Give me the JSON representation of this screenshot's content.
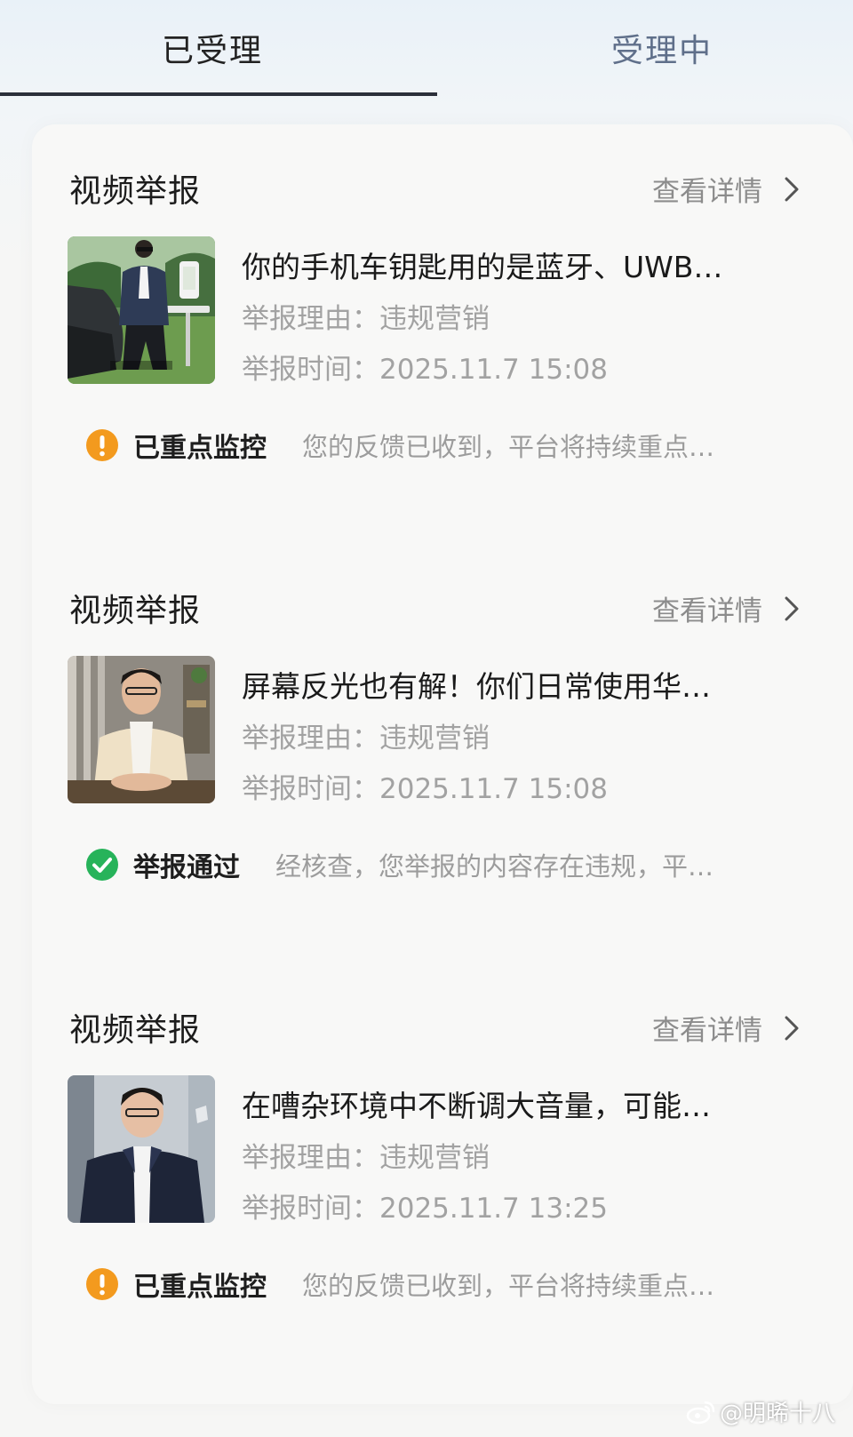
{
  "tabs": [
    {
      "label": "已受理",
      "active": true
    },
    {
      "label": "受理中",
      "active": false
    }
  ],
  "reports": [
    {
      "type": "视频举报",
      "detail_label": "查看详情",
      "title": "你的手机车钥匙用的是蓝牙、UWB…",
      "reason": "举报理由：违规营销",
      "time": "举报时间：2025.11.7 15:08",
      "status_label": "已重点监控",
      "status_icon": "warning-icon",
      "status_color": "#f39a1e",
      "status_message": "您的反馈已收到，平台将持续重点…"
    },
    {
      "type": "视频举报",
      "detail_label": "查看详情",
      "title": "屏幕反光也有解！你们日常使用华…",
      "reason": "举报理由：违规营销",
      "time": "举报时间：2025.11.7 15:08",
      "status_label": "举报通过",
      "status_icon": "check-icon",
      "status_color": "#27b35a",
      "status_message": "经核查，您举报的内容存在违规，平…"
    },
    {
      "type": "视频举报",
      "detail_label": "查看详情",
      "title": "在嘈杂环境中不断调大音量，可能…",
      "reason": "举报理由：违规营销",
      "time": "举报时间：2025.11.7 13:25",
      "status_label": "已重点监控",
      "status_icon": "warning-icon",
      "status_color": "#f39a1e",
      "status_message": "您的反馈已收到，平台将持续重点…"
    }
  ],
  "watermark": "@明晞十八"
}
